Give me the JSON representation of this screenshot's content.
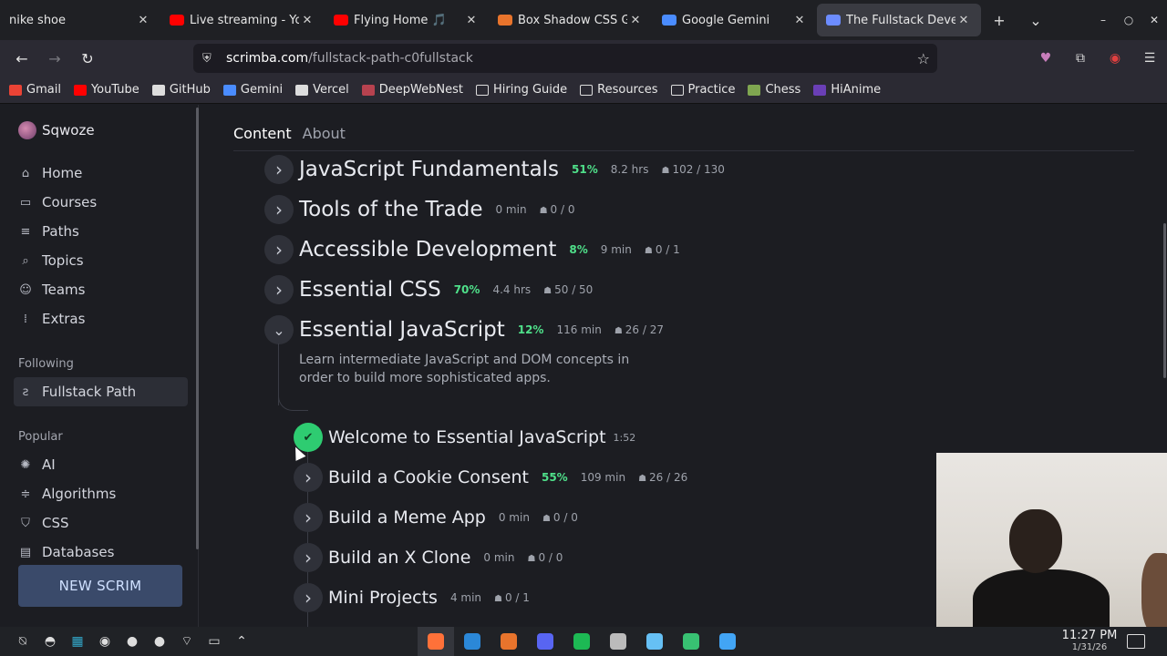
{
  "browser": {
    "tabs": [
      {
        "label": "nike shoe",
        "icon_color": "",
        "active": false
      },
      {
        "label": "Live streaming - You",
        "icon_color": "#ff0000",
        "active": false
      },
      {
        "label": "Flying Home 🎵",
        "icon_color": "#ff0000",
        "active": false
      },
      {
        "label": "Box Shadow CSS Ge",
        "icon_color": "#e8742c",
        "active": false
      },
      {
        "label": "Google Gemini",
        "icon_color": "#4a8cff",
        "active": false
      },
      {
        "label": "The Fullstack Devel",
        "icon_color": "#6c8cff",
        "active": true
      }
    ],
    "url_domain": "scrimba.com",
    "url_path": "/fullstack-path-c0fullstack",
    "bookmarks": [
      {
        "label": "Gmail",
        "icon": "gmail-icon",
        "color": "#ea4335"
      },
      {
        "label": "YouTube",
        "icon": "youtube-icon",
        "color": "#ff0000"
      },
      {
        "label": "GitHub",
        "icon": "github-icon",
        "color": "#dddddd"
      },
      {
        "label": "Gemini",
        "icon": "gemini-icon",
        "color": "#4a8cff"
      },
      {
        "label": "Vercel",
        "icon": "globe-icon",
        "color": "#dddddd"
      },
      {
        "label": "DeepWebNest",
        "icon": "deepwebnest-icon",
        "color": "#b7424f"
      },
      {
        "label": "Hiring Guide",
        "icon": "folder-icon",
        "color": ""
      },
      {
        "label": "Resources",
        "icon": "folder-icon",
        "color": ""
      },
      {
        "label": "Practice",
        "icon": "folder-icon",
        "color": ""
      },
      {
        "label": "Chess",
        "icon": "chess-icon",
        "color": "#7fa650"
      },
      {
        "label": "HiAnime",
        "icon": "hianime-icon",
        "color": "#6a3fb6"
      }
    ]
  },
  "sidebar": {
    "user_name": "Sqwoze",
    "nav": [
      {
        "label": "Home",
        "icon": "home-icon",
        "glyph": "⌂"
      },
      {
        "label": "Courses",
        "icon": "courses-icon",
        "glyph": "▭"
      },
      {
        "label": "Paths",
        "icon": "paths-icon",
        "glyph": "≡"
      },
      {
        "label": "Topics",
        "icon": "topics-icon",
        "glyph": "⌕"
      },
      {
        "label": "Teams",
        "icon": "teams-icon",
        "glyph": "☺"
      },
      {
        "label": "Extras",
        "icon": "extras-icon",
        "glyph": "⁞"
      }
    ],
    "following_heading": "Following",
    "following": [
      {
        "label": "Fullstack Path",
        "icon": "path-icon",
        "glyph": "ƨ"
      }
    ],
    "popular_heading": "Popular",
    "popular": [
      {
        "label": "AI",
        "icon": "ai-icon",
        "glyph": "✺"
      },
      {
        "label": "Algorithms",
        "icon": "algorithms-icon",
        "glyph": "≑"
      },
      {
        "label": "CSS",
        "icon": "css-icon",
        "glyph": "⛉"
      },
      {
        "label": "Databases",
        "icon": "databases-icon",
        "glyph": "▤"
      }
    ],
    "new_scrim": "NEW SCRIM"
  },
  "main": {
    "tabs": [
      {
        "label": "Content",
        "active": true
      },
      {
        "label": "About",
        "active": false
      }
    ],
    "modules": [
      {
        "title": "JavaScript Fundamentals",
        "percent": "51%",
        "duration": "8.2 hrs",
        "progress": "102 / 130",
        "expanded": false
      },
      {
        "title": "Tools of the Trade",
        "percent": "",
        "duration": "0 min",
        "progress": "0 / 0",
        "expanded": false
      },
      {
        "title": "Accessible Development",
        "percent": "8%",
        "duration": "9 min",
        "progress": "0 / 1",
        "expanded": false
      },
      {
        "title": "Essential CSS",
        "percent": "70%",
        "duration": "4.4 hrs",
        "progress": "50 / 50",
        "expanded": false
      },
      {
        "title": "Essential JavaScript",
        "percent": "12%",
        "duration": "116 min",
        "progress": "26 / 27",
        "expanded": true
      }
    ],
    "expanded_description": "Learn intermediate JavaScript and DOM concepts in order to build more sophisticated apps.",
    "lessons": [
      {
        "title": "Welcome to Essential JavaScript",
        "percent": "",
        "duration": "1:52",
        "progress": "",
        "completed": true
      },
      {
        "title": "Build a Cookie Consent",
        "percent": "55%",
        "duration": "109 min",
        "progress": "26 / 26",
        "completed": false
      },
      {
        "title": "Build a Meme App",
        "percent": "",
        "duration": "0 min",
        "progress": "0 / 0",
        "completed": false
      },
      {
        "title": "Build an X Clone",
        "percent": "",
        "duration": "0 min",
        "progress": "0 / 0",
        "completed": false
      },
      {
        "title": "Mini Projects",
        "percent": "",
        "duration": "4 min",
        "progress": "0 / 1",
        "completed": false
      }
    ]
  },
  "taskbar": {
    "apps": [
      {
        "name": "firefox-icon",
        "color": "#ff7139",
        "active": true
      },
      {
        "name": "vscode-icon",
        "color": "#2b88d8",
        "active": false
      },
      {
        "name": "terminal-icon",
        "color": "#e8742c",
        "active": false
      },
      {
        "name": "discord-icon",
        "color": "#5865f2",
        "active": false
      },
      {
        "name": "spotify-icon",
        "color": "#1db954",
        "active": false
      },
      {
        "name": "tool-icon",
        "color": "#bbbbbb",
        "active": false
      },
      {
        "name": "steam-icon",
        "color": "#66c0f4",
        "active": false
      },
      {
        "name": "roblox-icon",
        "color": "#38c172",
        "active": false
      },
      {
        "name": "flutter-icon",
        "color": "#42a5f5",
        "active": false
      }
    ],
    "time": "11:27 PM",
    "date": "1/31/26"
  },
  "colors": {
    "accent_green": "#4fe08a",
    "check_green": "#2ecc71",
    "new_scrim_bg": "#3a4a6a"
  }
}
